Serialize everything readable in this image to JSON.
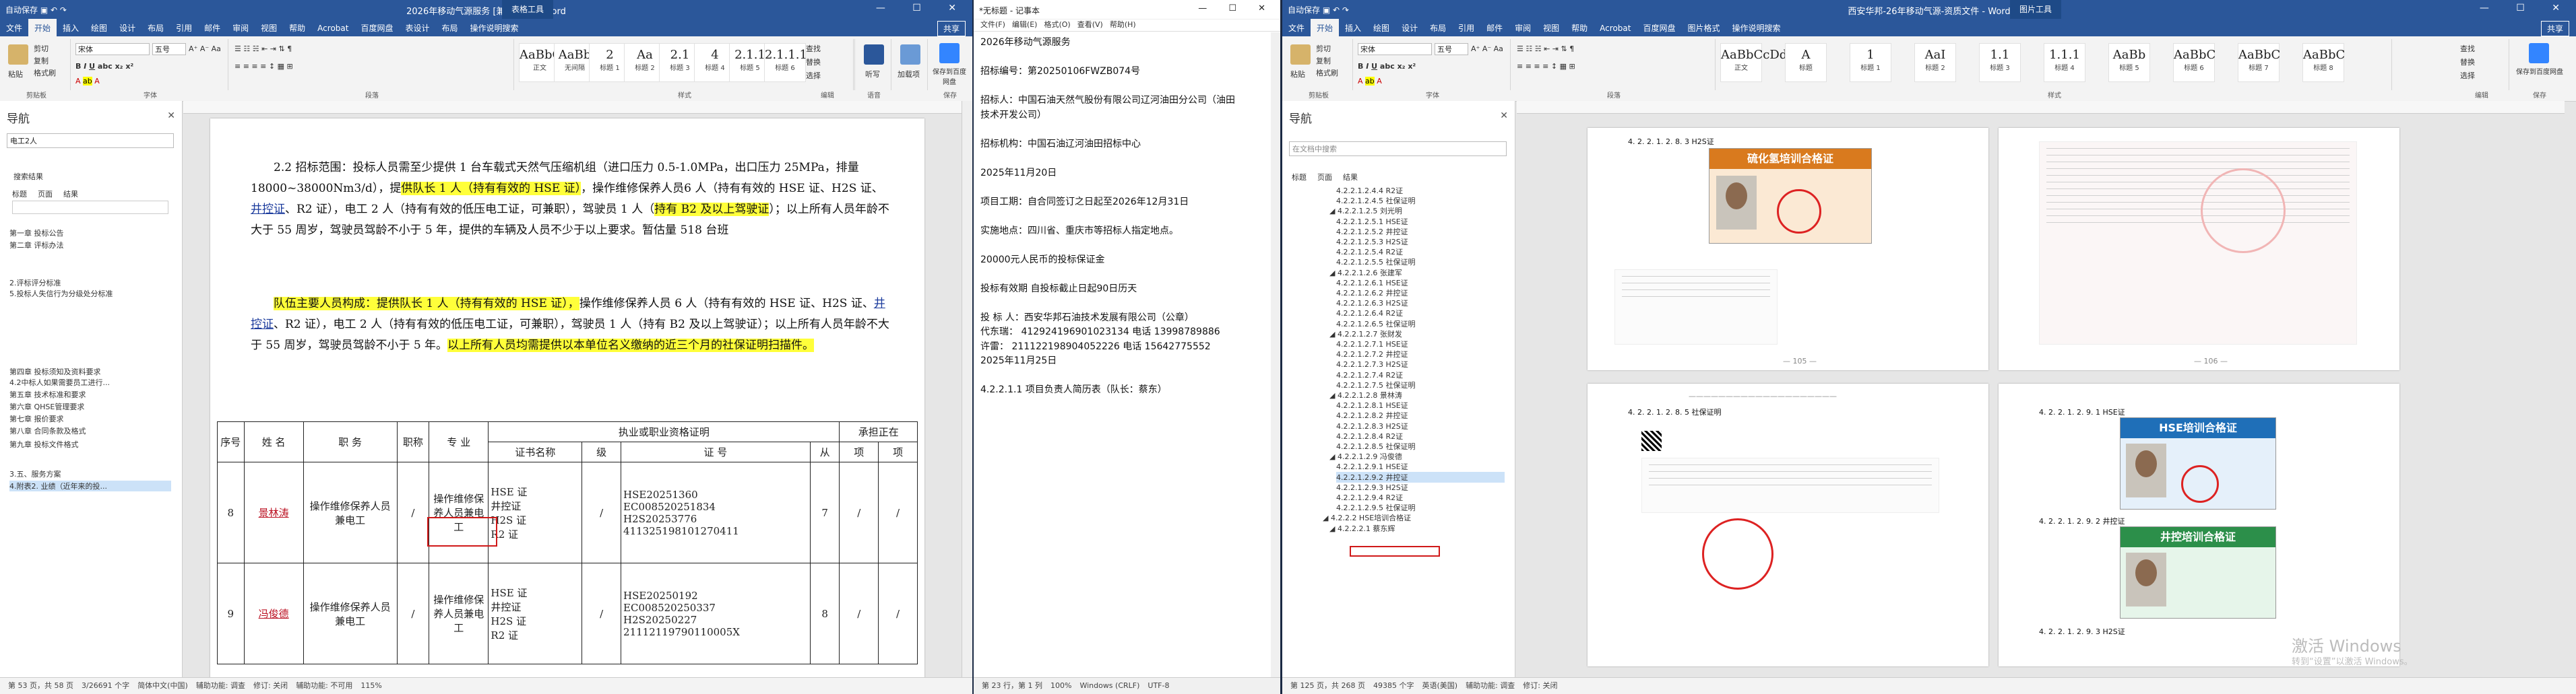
{
  "left_window": {
    "qat": "自动保存  ▣  ↶ ↷",
    "title": "2026年移动气源服务 [兼容模式] - Word",
    "context_tab": "表格工具",
    "window_controls": "— ☐ ✕",
    "tabs": [
      "文件",
      "开始",
      "插入",
      "绘图",
      "设计",
      "布局",
      "引用",
      "邮件",
      "审阅",
      "视图",
      "帮助",
      "Acrobat",
      "百度网盘",
      "表设计",
      "布局",
      "操作说明搜索"
    ],
    "share_label": "共享",
    "ribbon": {
      "clipboard_label": "剪贴板",
      "paste": "粘贴",
      "cut": "剪切",
      "copy": "复制",
      "format_painter": "格式刷",
      "font_label": "字体",
      "font_name": "宋体",
      "font_size": "五号",
      "paragraph_label": "段落",
      "styles_label": "样式",
      "styles": [
        {
          "preview": "AaBbC",
          "name": "正文"
        },
        {
          "preview": "AaBb",
          "name": "无间隔"
        },
        {
          "preview": "2",
          "name": "标题 1"
        },
        {
          "preview": "Aa",
          "name": "标题 2"
        },
        {
          "preview": "2.1",
          "name": "标题 3"
        },
        {
          "preview": "4",
          "name": "标题 4"
        },
        {
          "preview": "2.1.1",
          "name": "标题 5"
        },
        {
          "preview": "2.1.1.1",
          "name": "标题 6"
        }
      ],
      "find": "查找",
      "replace": "替换",
      "select": "选择",
      "editing_label": "编辑",
      "dictate": "听写",
      "voice_label": "语音",
      "save_baidu": "保存到百度网盘",
      "baidu_label": "保存",
      "addins": "加载项"
    },
    "nav": {
      "title": "导航",
      "search_value": "电工2人",
      "results_text": "搜索结果",
      "tabs": [
        "标题",
        "页面",
        "结果"
      ],
      "items": [
        "第一章 投标公告",
        "第二章 评标办法",
        "2.评标评分标准",
        "5.投标人失信行为分级处分标准",
        "第四章 投标须知及资料要求",
        "4.2中标人如果需要员工进行...",
        "第五章 技术标准和要求",
        "第六章 QHSE管理要求",
        "第七章 报价要求",
        "第八章 合同条款及格式",
        "第九章 投标文件格式",
        "3.五、服务方案",
        "4.附表2. 业绩（近年来的投..."
      ]
    },
    "doc": {
      "para1": [
        {
          "t": "2.2 招标范围：投标人员需至少提供 1 台车载式天然气压缩机组（进口压力 0.5-1.0MPa，出口"
        },
        {
          "t": "压力 25MPa，排量 18000~38000Nm3/d），提"
        },
        {
          "t": "供队长 1 人（持有有效的 HSE 证）",
          "h": true
        },
        {
          "t": "，操作维修保养人员"
        },
        {
          "t": "6 人（持有有效的 HSE 证、H2S 证、"
        },
        {
          "t": "井控证",
          "u": true
        },
        {
          "t": "、R2 证），电工 2 人（持有有效的低压电工证，可兼职），"
        },
        {
          "t": "驾驶员 1 人（"
        },
        {
          "t": "持有 B2 及以上驾驶证",
          "h": true
        },
        {
          "t": "）；以上所有人员年龄不大于 55 周岁，驾驶员驾龄不小于 5 年，"
        },
        {
          "t": "提供的车辆及人员不少于以上要求。暂估量 518 台班"
        }
      ],
      "para2": [
        {
          "t": "队伍主要人员构成：提供队长 1 人（持有有效的 HSE 证），",
          "h": true
        },
        {
          "t": "操作维修保养人员 6 人（持有有效"
        },
        {
          "t": "的 HSE 证、H2S 证、"
        },
        {
          "t": "井控证",
          "u": true
        },
        {
          "t": "、R2 证），电工 2 人（持有有效的低压电工证，可兼职），驾驶员 1 人"
        },
        {
          "t": "（持有 B2 及以上驾驶证）；以上所有人员年龄不大于 55 周岁，驾驶员驾龄不小于 5 年。"
        },
        {
          "t": "以上所有",
          "h": true
        },
        {
          "t": "人员均需提供以本单位名义缴纳的近三个月的社保证明扫描件。",
          "h": true
        }
      ],
      "table_header": {
        "seq": "序号",
        "name": "姓 名",
        "position": "职 务",
        "title": "职称",
        "major": "专 业",
        "qual_group": "执业或职业资格证明",
        "cert_name": "证书名称",
        "level": "级",
        "cert_no": "证 号",
        "from": "从",
        "proj_group": "承担正在",
        "proj1": "项",
        "proj2": "项"
      },
      "rows": [
        {
          "seq": "8",
          "name": "景林涛",
          "position": "操作维修保养人员兼电工",
          "title": "/",
          "major": "操作维修保养人员兼电工",
          "certs": [
            "HSE 证",
            "井控证",
            "H2S 证",
            "R2 证"
          ],
          "level": "/",
          "numbers": [
            "HSE20251360",
            "EC008520251834",
            "H2S20253776",
            "411325198101270411"
          ],
          "years": "7",
          "p1": "/",
          "p2": "/"
        },
        {
          "seq": "9",
          "name": "冯俊德",
          "position": "操作维修保养人员兼电工",
          "title": "/",
          "major": "操作维修保养人员兼电工",
          "certs": [
            "HSE 证",
            "井控证",
            "H2S 证",
            "R2 证"
          ],
          "level": "/",
          "numbers": [
            "HSE20250192",
            "EC008520250337",
            "H2S20250227",
            "21112119790110005X"
          ],
          "years": "8",
          "p1": "/",
          "p2": "/"
        }
      ]
    },
    "status": [
      "第 53 页，共 58 页",
      "3/26691 个字",
      "简体中文(中国)",
      "辅助功能: 调查",
      "修订: 关闭",
      "辅助功能: 不可用",
      "115%"
    ]
  },
  "notepad": {
    "title": "*无标题 - 记事本",
    "menu": [
      "文件(F)",
      "编辑(E)",
      "格式(O)",
      "查看(V)",
      "帮助(H)"
    ],
    "lines": [
      "2026年移动气源服务",
      "",
      "招标编号：第20250106FWZB074号",
      "",
      "招标人：中国石油天然气股份有限公司辽河油田分公司（油田",
      "技术开发公司）",
      "",
      "招标机构：中国石油辽河油田招标中心",
      "",
      "2025年11月20日",
      "",
      "项目工期：自合同签订之日起至2026年12月31日",
      "",
      "实施地点：四川省、重庆市等招标人指定地点。",
      "",
      "20000元人民币的投标保证金",
      "",
      "投标有效期  自投标截止日起90日历天",
      "",
      "投  标  人：西安华邦石油技术发展有限公司（公章）",
      "代东瑞：  412924196901023134 电话 13998789886",
      "许雷：    211122198904052226  电话 15642775552",
      "2025年11月25日",
      "",
      "4.2.2.1.1 项目负责人简历表（队长：蔡东）"
    ],
    "status": [
      "第 23 行，第 1 列",
      "100%",
      "Windows (CRLF)",
      "UTF-8"
    ]
  },
  "right_window": {
    "qat": "自动保存  ▣  ↶ ↷",
    "title": "西安华邦-26年移动气源-资质文件 - Word",
    "context_tab": "图片工具",
    "window_controls": "— ☐ ✕",
    "tabs": [
      "文件",
      "开始",
      "插入",
      "绘图",
      "设计",
      "布局",
      "引用",
      "邮件",
      "审阅",
      "视图",
      "帮助",
      "Acrobat",
      "百度网盘",
      "图片格式",
      "操作说明搜索"
    ],
    "share_label": "共享",
    "ribbon": {
      "paste": "粘贴",
      "cut": "剪切",
      "copy": "复制",
      "format_painter": "格式刷",
      "clipboard_label": "剪贴板",
      "font_name": "宋体",
      "font_size": "五号",
      "font_label": "字体",
      "paragraph_label": "段落",
      "styles_label": "样式",
      "styles": [
        {
          "preview": "AaBbCcDd",
          "name": "正文"
        },
        {
          "preview": "A",
          "name": "标题"
        },
        {
          "preview": "1",
          "name": "标题 1"
        },
        {
          "preview": "AaI",
          "name": "标题 2"
        },
        {
          "preview": "1.1",
          "name": "标题 3"
        },
        {
          "preview": "1.1.1",
          "name": "标题 4"
        },
        {
          "preview": "AaBb",
          "name": "标题 5"
        },
        {
          "preview": "AaBbC",
          "name": "标题 6"
        },
        {
          "preview": "AaBbC",
          "name": "标题 7"
        },
        {
          "preview": "AaBbC",
          "name": "标题 8"
        }
      ],
      "find": "查找",
      "replace": "替换",
      "select": "选择",
      "editing_label": "编辑",
      "save_baidu": "保存到百度网盘",
      "baidu_label": "保存"
    },
    "nav": {
      "title": "导航",
      "search_placeholder": "在文档中搜索",
      "tabs": [
        "标题",
        "页面",
        "结果"
      ],
      "items": [
        {
          "t": "4.2.2.1.2.4.4 R2证",
          "lvl": 3
        },
        {
          "t": "4.2.2.1.2.4.5 社保证明",
          "lvl": 3
        },
        {
          "t": "4.2.2.1.2.5 刘光明",
          "lvl": 2
        },
        {
          "t": "4.2.2.1.2.5.1 HSE证",
          "lvl": 3
        },
        {
          "t": "4.2.2.1.2.5.2 井控证",
          "lvl": 3
        },
        {
          "t": "4.2.2.1.2.5.3 H2S证",
          "lvl": 3
        },
        {
          "t": "4.2.2.1.2.5.4 R2证",
          "lvl": 3
        },
        {
          "t": "4.2.2.1.2.5.5 社保证明",
          "lvl": 3
        },
        {
          "t": "4.2.2.1.2.6 张建军",
          "lvl": 2
        },
        {
          "t": "4.2.2.1.2.6.1 HSE证",
          "lvl": 3
        },
        {
          "t": "4.2.2.1.2.6.2 井控证",
          "lvl": 3
        },
        {
          "t": "4.2.2.1.2.6.3 H2S证",
          "lvl": 3
        },
        {
          "t": "4.2.2.1.2.6.4 R2证",
          "lvl": 3
        },
        {
          "t": "4.2.2.1.2.6.5 社保证明",
          "lvl": 3
        },
        {
          "t": "4.2.2.1.2.7 张财发",
          "lvl": 2
        },
        {
          "t": "4.2.2.1.2.7.1 HSE证",
          "lvl": 3
        },
        {
          "t": "4.2.2.1.2.7.2 井控证",
          "lvl": 3
        },
        {
          "t": "4.2.2.1.2.7.3 H2S证",
          "lvl": 3
        },
        {
          "t": "4.2.2.1.2.7.4 R2证",
          "lvl": 3
        },
        {
          "t": "4.2.2.1.2.7.5 社保证明",
          "lvl": 3
        },
        {
          "t": "4.2.2.1.2.8 景林涛",
          "lvl": 2
        },
        {
          "t": "4.2.2.1.2.8.1 HSE证",
          "lvl": 3
        },
        {
          "t": "4.2.2.1.2.8.2 井控证",
          "lvl": 3
        },
        {
          "t": "4.2.2.1.2.8.3 H2S证",
          "lvl": 3
        },
        {
          "t": "4.2.2.1.2.8.4 R2证",
          "lvl": 3
        },
        {
          "t": "4.2.2.1.2.8.5 社保证明",
          "lvl": 3
        },
        {
          "t": "4.2.2.1.2.9 冯俊德",
          "lvl": 2
        },
        {
          "t": "4.2.2.1.2.9.1 HSE证",
          "lvl": 3
        },
        {
          "t": "4.2.2.1.2.9.2 井控证",
          "lvl": 3
        },
        {
          "t": "4.2.2.1.2.9.3 H2S证",
          "lvl": 3
        },
        {
          "t": "4.2.2.1.2.9.4 R2证",
          "lvl": 3
        },
        {
          "t": "4.2.2.1.2.9.5 社保证明",
          "lvl": 3
        },
        {
          "t": "4.2.2.2 HSE培训合格证",
          "lvl": 1
        },
        {
          "t": "4.2.2.2.1 蔡东辉",
          "lvl": 2
        }
      ],
      "selected_index": 28,
      "boxed_index": 26
    },
    "pages": {
      "cap_tl": "4. 2. 2. 1. 2. 8. 3 H2S证",
      "cert_tl_title": "硫化氢培训合格证",
      "cap_bl": "4. 2. 2. 1. 2. 8. 5 社保证明",
      "cap_br1": "4. 2. 2. 1. 2. 9. 1 HSE证",
      "cert_br1_title": "HSE培训合格证",
      "cap_br2": "4. 2. 2. 1. 2. 9. 2 井控证",
      "cert_br2_title": "井控培训合格证",
      "cap_br3": "4. 2. 2. 1. 2. 9. 3 H2S证"
    },
    "watermark_line1": "激活 Windows",
    "watermark_line2": "转到“设置”以激活 Windows。",
    "status": [
      "第 125 页，共 268 页",
      "49385 个字",
      "英语(美国)",
      "辅助功能: 调查",
      "修订: 关闭"
    ]
  },
  "colors": {
    "word_blue": "#2b579a",
    "highlight": "#ffff3a",
    "cert_orange": "#d97a1e",
    "cert_blue": "#1f6fb8",
    "cert_green": "#2c8f4a",
    "red_box": "#d01919"
  }
}
